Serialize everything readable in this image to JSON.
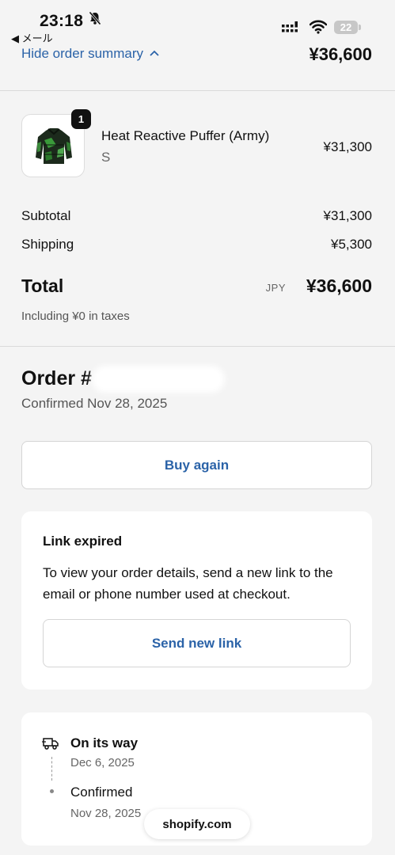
{
  "status_bar": {
    "time": "23:18",
    "back_label": "◀ メール",
    "battery": "22"
  },
  "summary": {
    "toggle_label": "Hide order summary",
    "total": "¥36,600"
  },
  "item": {
    "name": "Heat Reactive Puffer (Army)",
    "variant": "S",
    "price": "¥31,300",
    "quantity": "1"
  },
  "totals": {
    "subtotal_label": "Subtotal",
    "subtotal_value": "¥31,300",
    "shipping_label": "Shipping",
    "shipping_value": "¥5,300",
    "total_label": "Total",
    "currency": "JPY",
    "total_value": "¥36,600",
    "tax_note": "Including ¥0 in taxes"
  },
  "order": {
    "title": "Order #",
    "confirmed": "Confirmed Nov 28, 2025",
    "buy_again_label": "Buy again"
  },
  "link_card": {
    "title": "Link expired",
    "body": "To view your order details, send a new link to the email or phone number used at checkout.",
    "button_label": "Send new link"
  },
  "tracking": {
    "steps": [
      {
        "title": "On its way",
        "date": "Dec 6, 2025"
      },
      {
        "title": "Confirmed",
        "date": "Nov 28, 2025"
      }
    ]
  },
  "footer": {
    "domain": "shopify.com"
  },
  "colors": {
    "accent": "#2b63a8",
    "background": "#f4f4f4"
  }
}
